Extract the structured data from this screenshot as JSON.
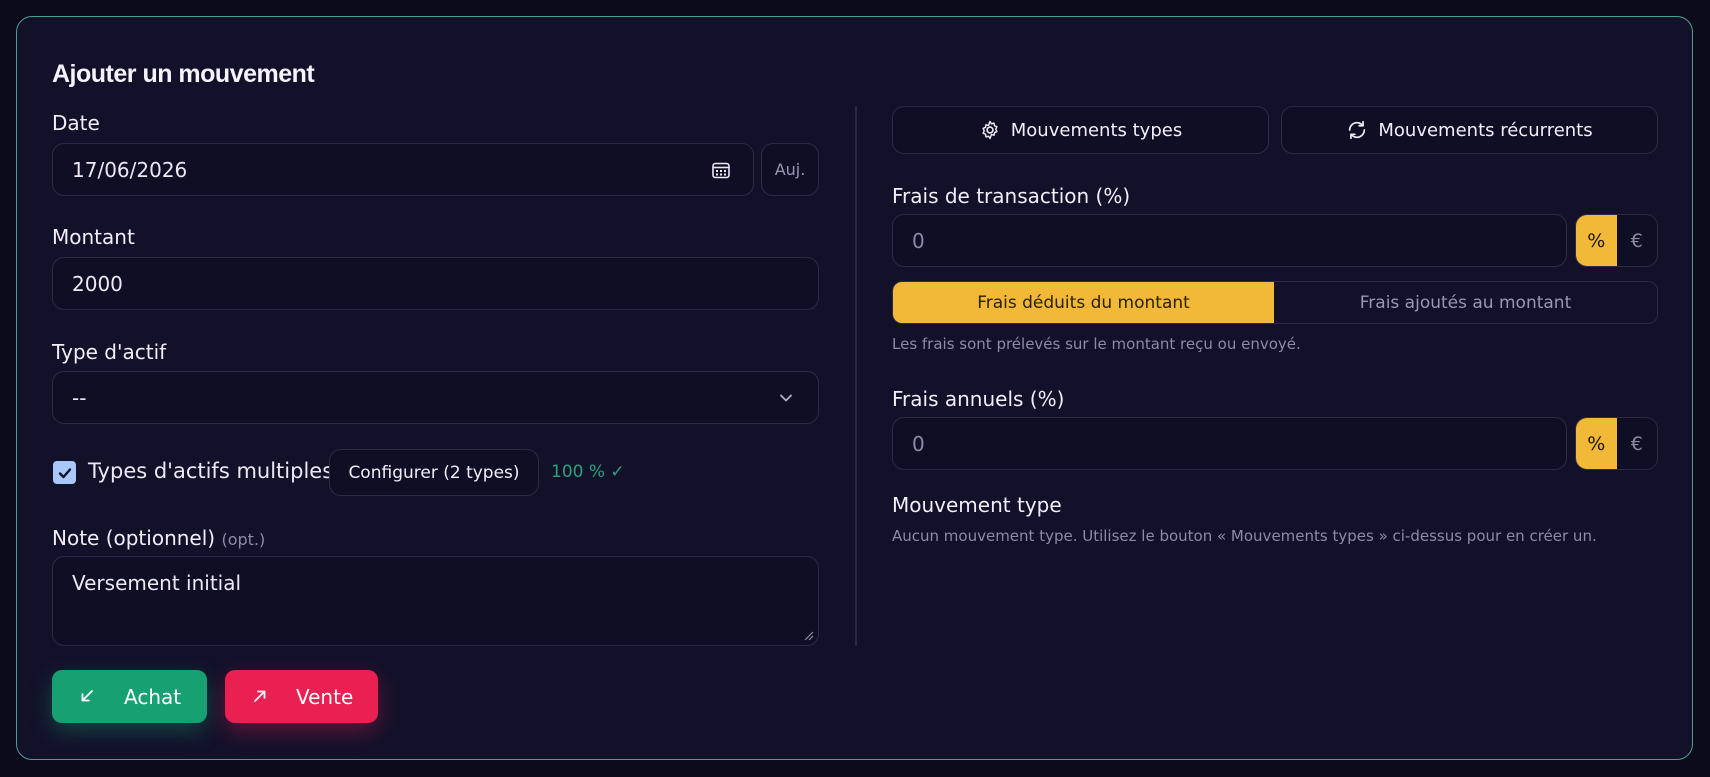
{
  "form": {
    "title": "Ajouter un mouvement",
    "date": {
      "label": "Date",
      "value": "17/06/2026",
      "today_label": "Auj."
    },
    "amount": {
      "label": "Montant",
      "value": "2000"
    },
    "asset_type": {
      "label": "Type d'actif",
      "selected": "--"
    },
    "multi_types": {
      "checked": true,
      "label": "Types d'actifs multiples",
      "configure_label": "Configurer (2 types)",
      "status": "100 % ✓"
    },
    "note": {
      "label": "Note (optionnel)",
      "optional_tag": "(opt.)",
      "value": "Versement initial"
    },
    "actions": {
      "buy_label": "Achat",
      "sell_label": "Vente"
    }
  },
  "right": {
    "template_button": "Mouvements types",
    "recurring_button": "Mouvements récurrents",
    "transaction_fees": {
      "label": "Frais de transaction (%)",
      "value": "0",
      "unit_percent": "%",
      "unit_euro": "€",
      "deducted_label": "Frais déduits du montant",
      "added_label": "Frais ajoutés au montant",
      "hint": "Les frais sont prélevés sur le montant reçu ou envoyé."
    },
    "annual_fees": {
      "label": "Frais annuels (%)",
      "value": "0",
      "unit_percent": "%",
      "unit_euro": "€"
    },
    "movement_type": {
      "label": "Mouvement type",
      "empty_text": "Aucun mouvement type. Utilisez le bouton « Mouvements types » ci-dessus pour en créer un."
    }
  },
  "colors": {
    "background": "#0c0b1c",
    "card": "#13112a",
    "card_border": "#4e9d8c",
    "accent_yellow": "#f2b838",
    "buy_green": "#17a173",
    "sell_red": "#ea1f52",
    "success_text": "#2aa37d"
  },
  "icons": {
    "calendar": "calendar-icon",
    "chevron": "chevron-down-icon",
    "check": "check-icon",
    "buy": "arrow-down-left-icon",
    "sell": "arrow-up-right-icon",
    "gear": "gear-icon",
    "refresh": "refresh-icon"
  }
}
